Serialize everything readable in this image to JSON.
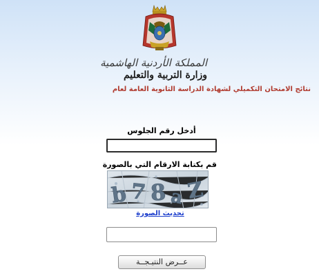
{
  "header": {
    "kingdom_name": "المملكة الأردنية الهاشمية",
    "ministry_name": "وزارة التربية والتعليم",
    "results_title": "نتائج الامتحان التكميلي لشهادة الدراسة الثانوية العامة لعام"
  },
  "form": {
    "seat_number_label": "أدخل رقم الجلوس",
    "seat_number_value": "",
    "captcha_label": "قم بكتابة الارقام التي بالصورة",
    "captcha_text": "b78aZ",
    "refresh_link": "تحديث الصورة",
    "captcha_value": "",
    "submit_label": "عــرض النتيـجــة"
  },
  "colors": {
    "title_red": "#b03a2e",
    "link_blue": "#1a3ccc"
  }
}
